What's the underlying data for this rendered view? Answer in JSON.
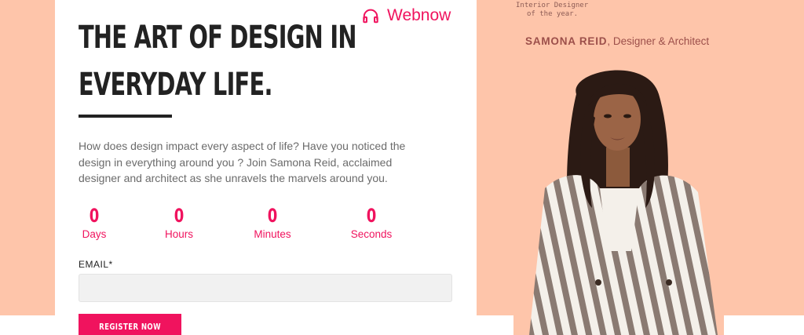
{
  "brand": {
    "name": "Webnow",
    "accent": "#f0135e"
  },
  "hero": {
    "headline_line1": "THE ART OF DESIGN IN",
    "headline_line2": "EVERYDAY LIFE.",
    "description": "How does design impact every aspect of life? Have you noticed the design in everything around you ? Join Samona Reid, acclaimed designer and architect as she unravels the marvels around you."
  },
  "countdown": [
    {
      "value": "0",
      "label": "Days"
    },
    {
      "value": "0",
      "label": "Hours"
    },
    {
      "value": "0",
      "label": "Minutes"
    },
    {
      "value": "0",
      "label": "Seconds"
    }
  ],
  "form": {
    "email_label": "EMAIL*",
    "email_value": "",
    "register_label": "REGISTER NOW"
  },
  "sidebar": {
    "award_line1": "Interior Designer",
    "award_line2": "of the year.",
    "speaker_name": "SAMONA REID",
    "speaker_role": ", Designer & Architect"
  },
  "colors": {
    "background": "#fec5aa",
    "card": "#ffffff",
    "text_dark": "#222222"
  }
}
